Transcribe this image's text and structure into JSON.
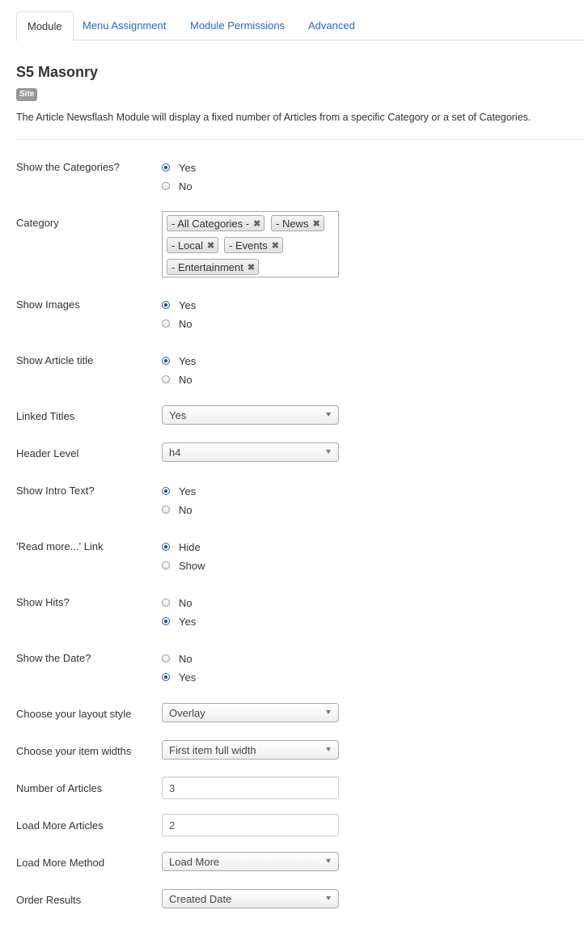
{
  "tabs": [
    {
      "label": "Module"
    },
    {
      "label": "Menu Assignment"
    },
    {
      "label": "Module Permissions"
    },
    {
      "label": "Advanced"
    }
  ],
  "module": {
    "title": "S5 Masonry",
    "badge": "Site",
    "description": "The Article Newsflash Module will display a fixed number of Articles from a specific Category or a set of Categories."
  },
  "fields": {
    "show_categories": {
      "label": "Show the Categories?",
      "options": [
        "Yes",
        "No"
      ],
      "selected": "Yes"
    },
    "category": {
      "label": "Category",
      "chips": [
        "- All Categories -",
        "- News",
        "- Local",
        "- Events",
        "- Entertainment"
      ],
      "remove_glyph": "✖"
    },
    "show_images": {
      "label": "Show Images",
      "options": [
        "Yes",
        "No"
      ],
      "selected": "Yes"
    },
    "show_article_title": {
      "label": "Show Article title",
      "options": [
        "Yes",
        "No"
      ],
      "selected": "Yes"
    },
    "linked_titles": {
      "label": "Linked Titles",
      "value": "Yes"
    },
    "header_level": {
      "label": "Header Level",
      "value": "h4"
    },
    "show_intro_text": {
      "label": "Show Intro Text?",
      "options": [
        "Yes",
        "No"
      ],
      "selected": "Yes"
    },
    "read_more": {
      "label": "'Read more...' Link",
      "options": [
        "Hide",
        "Show"
      ],
      "selected": "Hide"
    },
    "show_hits": {
      "label": "Show Hits?",
      "options": [
        "No",
        "Yes"
      ],
      "selected": "Yes"
    },
    "show_date": {
      "label": "Show the Date?",
      "options": [
        "No",
        "Yes"
      ],
      "selected": "Yes"
    },
    "layout_style": {
      "label": "Choose your layout style",
      "value": "Overlay"
    },
    "item_widths": {
      "label": "Choose your item widths",
      "value": "First item full width"
    },
    "number_of_articles": {
      "label": "Number of Articles",
      "value": "3"
    },
    "load_more_articles": {
      "label": "Load More Articles",
      "value": "2"
    },
    "load_more_method": {
      "label": "Load More Method",
      "value": "Load More"
    },
    "order_results": {
      "label": "Order Results",
      "value": "Created Date"
    }
  }
}
